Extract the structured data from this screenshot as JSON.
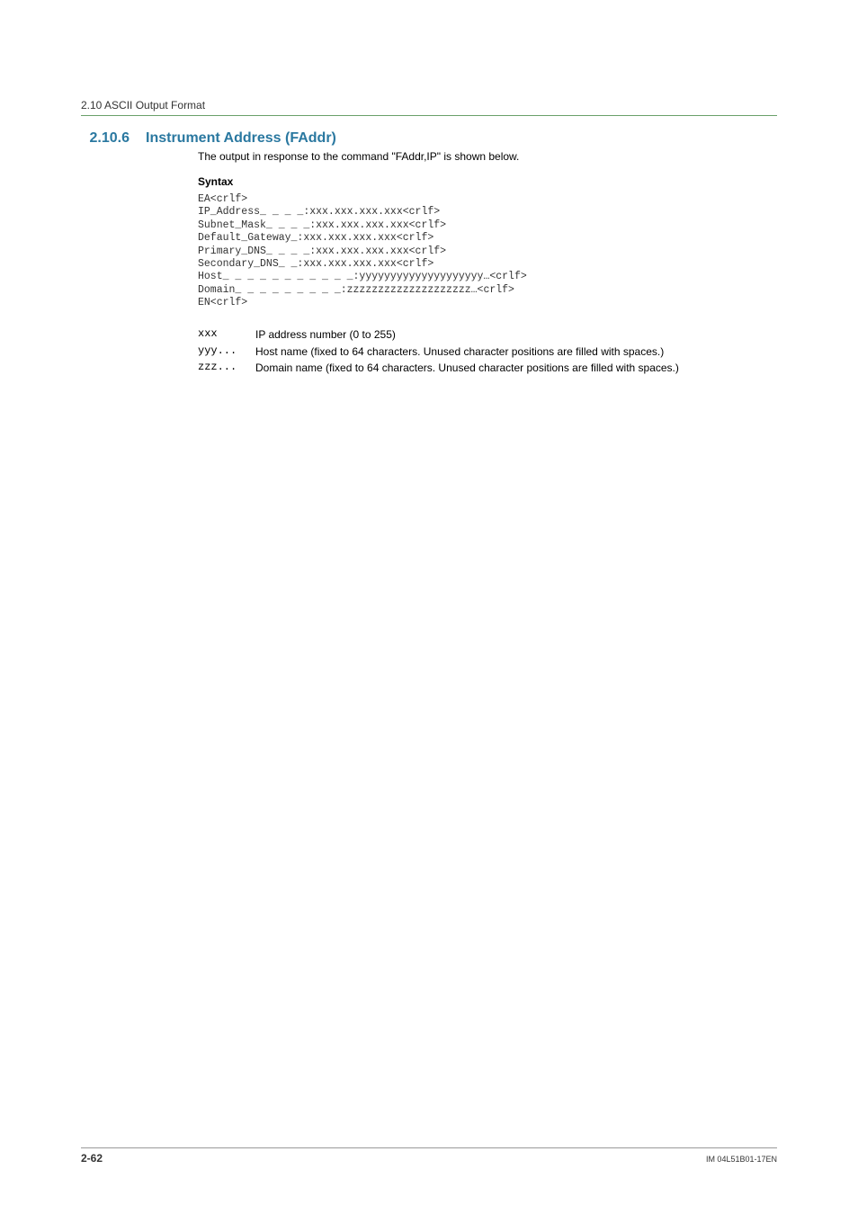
{
  "breadcrumb": "2.10  ASCII Output Format",
  "section": {
    "number": "2.10.6",
    "title": "Instrument Address (FAddr)"
  },
  "intro": "The output in response to the command \"FAddr,IP\" is shown below.",
  "syntax_label": "Syntax",
  "syntax_code": "EA<crlf>\nIP_Address_ _ _ _:xxx.xxx.xxx.xxx<crlf>\nSubnet_Mask_ _ _ _:xxx.xxx.xxx.xxx<crlf>\nDefault_Gateway_:xxx.xxx.xxx.xxx<crlf>\nPrimary_DNS_ _ _ _:xxx.xxx.xxx.xxx<crlf>\nSecondary_DNS_ _:xxx.xxx.xxx.xxx<crlf>\nHost_ _ _ _ _ _ _ _ _ _ _:yyyyyyyyyyyyyyyyyyyy…<crlf>\nDomain_ _ _ _ _ _ _ _ _:zzzzzzzzzzzzzzzzzzzz…<crlf>\nEN<crlf>",
  "definitions": [
    {
      "term": "xxx",
      "desc": "IP address number (0 to 255)"
    },
    {
      "term": "yyy...",
      "desc": "Host name (fixed to 64 characters. Unused character positions are filled with spaces.)"
    },
    {
      "term": "zzz...",
      "desc": "Domain name (fixed to 64 characters. Unused character positions are filled with spaces.)"
    }
  ],
  "footer": {
    "page": "2-62",
    "doc": "IM 04L51B01-17EN"
  }
}
